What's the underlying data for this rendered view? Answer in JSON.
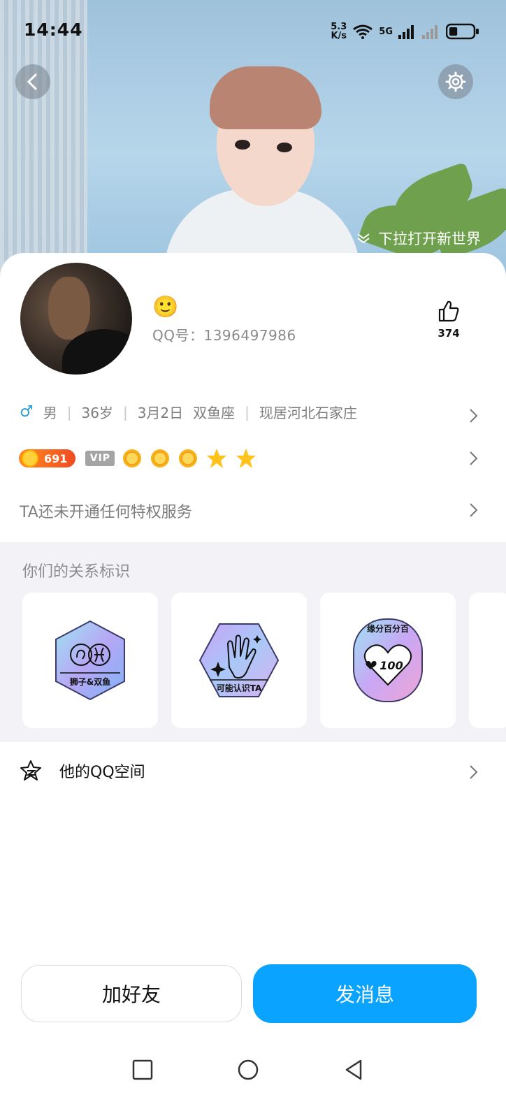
{
  "status_bar": {
    "time": "14:44",
    "net_speed_value": "5.3",
    "net_speed_unit": "K/s",
    "network_type": "5G",
    "battery_level": 0.35
  },
  "header": {
    "pull_hint": "下拉打开新世界",
    "back_icon": "chevron-left-icon",
    "settings_icon": "gear-icon"
  },
  "profile": {
    "nickname": "🙂",
    "qq_label": "QQ号：1396497986",
    "likes": "374",
    "info": {
      "gender_symbol": "♂",
      "gender": "男",
      "age": "36岁",
      "birthday": "3月2日",
      "zodiac": "双鱼座",
      "location": "现居河北石家庄"
    },
    "level": "691",
    "vip_label": "VIP",
    "level_icons": [
      "sun",
      "sun",
      "sun",
      "star",
      "star"
    ],
    "privilege_text": "TA还未开通任何特权服务"
  },
  "relationship": {
    "title": "你们的关系标识",
    "tags": [
      {
        "label": "狮子&双鱼"
      },
      {
        "label": "可能认识TA"
      },
      {
        "label": "缘分百分百",
        "value": "100"
      }
    ]
  },
  "zone": {
    "label": "他的QQ空间"
  },
  "actions": {
    "add_friend": "加好友",
    "send_message": "发消息"
  },
  "colors": {
    "primary": "#0aa3ff",
    "level_badge": "#f04a24",
    "gender_male": "#2b9bd6"
  }
}
